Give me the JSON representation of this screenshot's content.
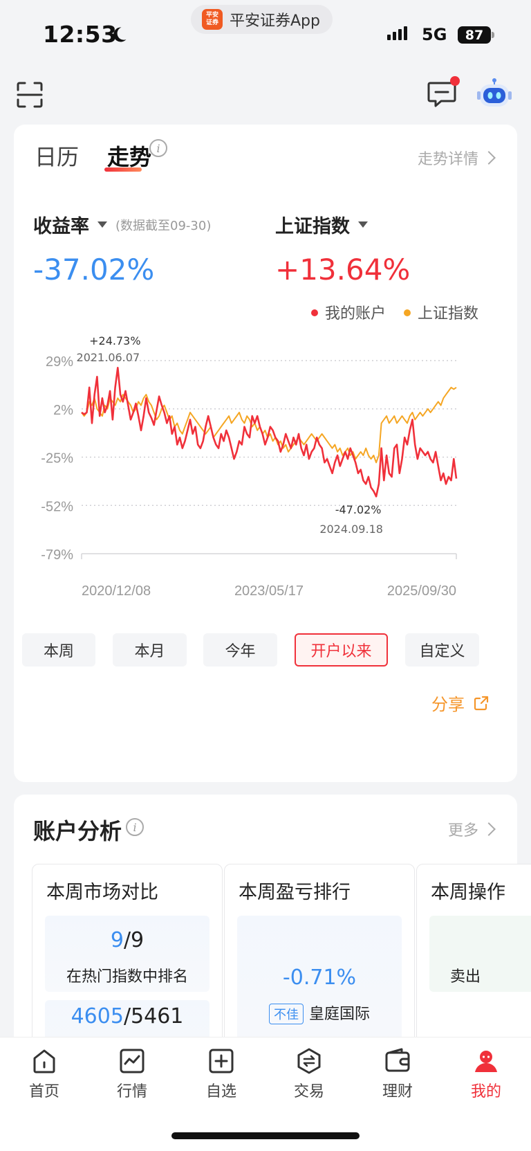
{
  "status_bar": {
    "time": "12:53",
    "network": "5G",
    "battery": "87",
    "app_pill": "平安证券App",
    "app_logo_text": "平安\n证券"
  },
  "tabs": {
    "calendar": "日历",
    "trend": "走势",
    "detail": "走势详情"
  },
  "metrics": {
    "return_label": "收益率",
    "return_note": "(数据截至09-30)",
    "return_value": "-37.02%",
    "index_label": "上证指数",
    "index_value": "+13.64%"
  },
  "legend": {
    "account": "我的账户",
    "index": "上证指数"
  },
  "chart_data": {
    "type": "line",
    "ylim": [
      -79,
      29
    ],
    "y_ticks": [
      "29%",
      "2%",
      "-25%",
      "-52%",
      "-79%"
    ],
    "y_tick_values": [
      29,
      2,
      -25,
      -52,
      -79
    ],
    "x_ticks": [
      "2020/12/08",
      "2023/05/17",
      "2025/09/30"
    ],
    "annotations": [
      {
        "value": "+24.73%",
        "date": "2021.06.07",
        "series": "我的账户"
      },
      {
        "value": "-47.02%",
        "date": "2024.09.18",
        "series": "我的账户"
      }
    ],
    "series": [
      {
        "name": "我的账户",
        "color": "#f0303a",
        "values": [
          0,
          -1,
          0,
          14,
          -6,
          10,
          20,
          -2,
          8,
          0,
          4,
          12,
          -4,
          14,
          25,
          10,
          6,
          12,
          4,
          -4,
          0,
          5,
          -2,
          -10,
          -2,
          8,
          0,
          -3,
          -7,
          1,
          9,
          4,
          0,
          -6,
          -2,
          -12,
          -8,
          -18,
          -14,
          -20,
          -16,
          -10,
          -4,
          -12,
          -8,
          -18,
          -20,
          -16,
          -8,
          -2,
          -8,
          -14,
          -18,
          -20,
          -12,
          -16,
          -10,
          -14,
          -20,
          -26,
          -22,
          -16,
          -18,
          -8,
          -12,
          -14,
          -2,
          -6,
          -2,
          -8,
          -12,
          -18,
          -14,
          -8,
          -10,
          -14,
          -16,
          -22,
          -18,
          -12,
          -16,
          -20,
          -14,
          -18,
          -12,
          -20,
          -24,
          -18,
          -26,
          -22,
          -20,
          -14,
          -18,
          -20,
          -28,
          -26,
          -30,
          -34,
          -28,
          -24,
          -30,
          -26,
          -22,
          -26,
          -20,
          -24,
          -28,
          -34,
          -32,
          -38,
          -40,
          -36,
          -42,
          -44,
          -47,
          -40,
          -20,
          -38,
          -24,
          -34,
          -36,
          -20,
          -18,
          -34,
          -26,
          -14,
          -18,
          -10,
          -4,
          -18,
          -26,
          -20,
          -22,
          -24,
          -22,
          -26,
          -28,
          -22,
          -30,
          -38,
          -34,
          -40,
          -36,
          -38,
          -26,
          -37
        ]
      },
      {
        "name": "上证指数",
        "color": "#f5a623",
        "values": [
          0,
          -2,
          0,
          6,
          4,
          8,
          2,
          0,
          -2,
          4,
          2,
          8,
          6,
          4,
          8,
          6,
          10,
          8,
          6,
          4,
          0,
          2,
          6,
          4,
          8,
          10,
          6,
          4,
          0,
          -4,
          -2,
          2,
          4,
          0,
          -4,
          -2,
          -8,
          -6,
          -10,
          -12,
          -8,
          -4,
          0,
          -2,
          -4,
          -6,
          -8,
          -10,
          -12,
          -10,
          -8,
          -14,
          -12,
          -10,
          -8,
          -6,
          -4,
          -2,
          -6,
          -4,
          -2,
          0,
          -4,
          -6,
          -2,
          -4,
          -8,
          -6,
          -10,
          -8,
          -12,
          -10,
          -14,
          -12,
          -16,
          -14,
          -18,
          -16,
          -20,
          -18,
          -22,
          -20,
          -18,
          -16,
          -14,
          -16,
          -18,
          -16,
          -14,
          -12,
          -14,
          -16,
          -14,
          -12,
          -14,
          -16,
          -18,
          -20,
          -18,
          -22,
          -20,
          -24,
          -22,
          -20,
          -24,
          -22,
          -26,
          -24,
          -22,
          -24,
          -20,
          -24,
          -26,
          -24,
          -28,
          -24,
          -6,
          -4,
          -2,
          -6,
          -4,
          -2,
          -6,
          -4,
          -2,
          -4,
          -6,
          -2,
          0,
          -4,
          -2,
          0,
          -2,
          0,
          2,
          0,
          2,
          4,
          6,
          4,
          8,
          10,
          12,
          14,
          13,
          14
        ]
      }
    ]
  },
  "ranges": [
    "本周",
    "本月",
    "今年",
    "开户以来",
    "自定义"
  ],
  "active_range": "开户以来",
  "share": "分享",
  "analysis": {
    "title": "账户分析",
    "more": "更多",
    "cards": [
      {
        "title": "本周市场对比",
        "rank_a": "9",
        "rank_b": "/9",
        "desc": "在热门指数中排名",
        "rank2_a": "4605",
        "rank2_b": "/5461"
      },
      {
        "title": "本周盈亏排行",
        "value": "-0.71%",
        "badge": "不佳",
        "stock": "皇庭国际"
      },
      {
        "title": "本周操作",
        "desc": "卖出"
      }
    ]
  },
  "nav": [
    {
      "label": "首页",
      "icon": "home-icon"
    },
    {
      "label": "行情",
      "icon": "market-icon"
    },
    {
      "label": "自选",
      "icon": "watchlist-add-icon"
    },
    {
      "label": "交易",
      "icon": "trade-icon"
    },
    {
      "label": "理财",
      "icon": "wallet-icon"
    },
    {
      "label": "我的",
      "icon": "profile-icon"
    }
  ],
  "colors": {
    "accent_red": "#f0303a",
    "accent_blue": "#3b8ef0",
    "accent_orange": "#f5962b"
  }
}
